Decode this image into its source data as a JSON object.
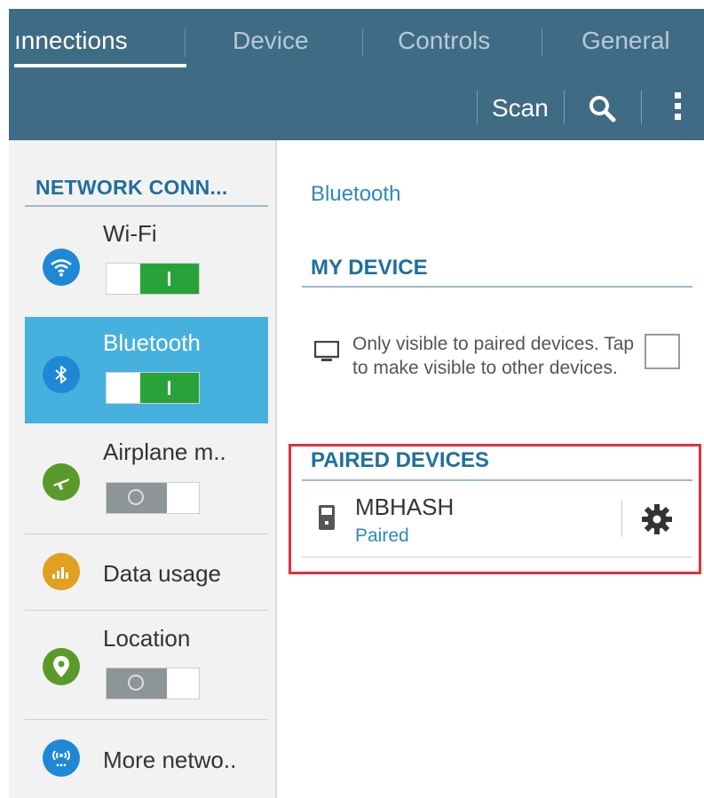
{
  "tabs": [
    {
      "label": "ınnections",
      "active": true
    },
    {
      "label": "Device",
      "active": false
    },
    {
      "label": "Controls",
      "active": false
    },
    {
      "label": "General",
      "active": false
    }
  ],
  "actions": {
    "scan": "Scan",
    "search_icon": "search-icon",
    "more_icon": "overflow-menu-icon"
  },
  "sidebar": {
    "title": "NETWORK CONN...",
    "items": [
      {
        "label": "Wi-Fi",
        "icon": "wifi-icon",
        "icon_color": "#1e88d6",
        "toggle": "on"
      },
      {
        "label": "Bluetooth",
        "icon": "bluetooth-icon",
        "icon_color": "#1e88d6",
        "toggle": "on",
        "selected": true
      },
      {
        "label": "Airplane m..",
        "icon": "airplane-icon",
        "icon_color": "#5a9a2a",
        "toggle": "off"
      },
      {
        "label": "Data usage",
        "icon": "bar-chart-icon",
        "icon_color": "#e2a020"
      },
      {
        "label": "Location",
        "icon": "location-pin-icon",
        "icon_color": "#5a9a2a",
        "toggle": "off"
      },
      {
        "label": "More netwo..",
        "icon": "antenna-icon",
        "icon_color": "#1e88d6"
      }
    ]
  },
  "main": {
    "title": "Bluetooth",
    "my_device": {
      "header": "MY DEVICE",
      "visibility_text": "Only visible to paired devices. Tap to make visible to other devices.",
      "visible_checked": false
    },
    "paired": {
      "header": "PAIRED DEVICES",
      "devices": [
        {
          "name": "MBHASH",
          "status": "Paired"
        }
      ]
    }
  },
  "colors": {
    "header_bg": "#3f6b85",
    "accent": "#1f6f9c",
    "selected_bg": "#46b0de",
    "toggle_on": "#28a33a",
    "highlight": "#e03040"
  }
}
